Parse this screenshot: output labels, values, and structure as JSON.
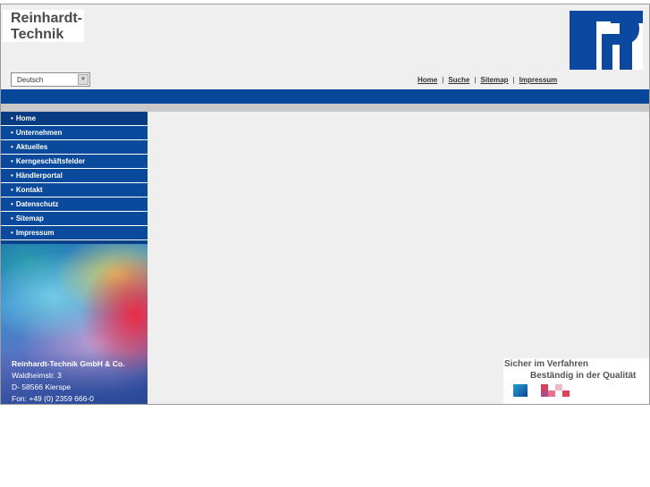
{
  "header": {
    "wordmark_line1": "Reinhardt-",
    "wordmark_line2": "Technik",
    "logo_icon": "rt-logo-icon",
    "language_select": {
      "selected": "Deutsch"
    }
  },
  "topnav": {
    "items": [
      {
        "label": "Home"
      },
      {
        "label": "Suche"
      },
      {
        "label": "Sitemap"
      },
      {
        "label": "Impressum"
      }
    ],
    "separator": "|"
  },
  "sidebar": {
    "bullet": "•",
    "items": [
      {
        "label": "Home"
      },
      {
        "label": "Unternehmen"
      },
      {
        "label": "Aktuelles"
      },
      {
        "label": "Kerngeschäftsfelder"
      },
      {
        "label": "Händlerportal"
      },
      {
        "label": "Kontakt"
      },
      {
        "label": "Datenschutz"
      },
      {
        "label": "Sitemap"
      },
      {
        "label": "Impressum"
      }
    ],
    "address": {
      "company": "Reinhardt-Technik GmbH & Co.",
      "street": "Waldheimstr. 3",
      "city": "D- 58566 Kierspe",
      "phone": "Fon: +49 (0) 2359 666-0"
    }
  },
  "slogan": {
    "line1": "Sicher im Verfahren",
    "line2": "Beständig in der Qualität"
  },
  "colors": {
    "brand_blue": "#06479a",
    "menu_blue": "#0a4a9c",
    "background": "#efefef"
  }
}
